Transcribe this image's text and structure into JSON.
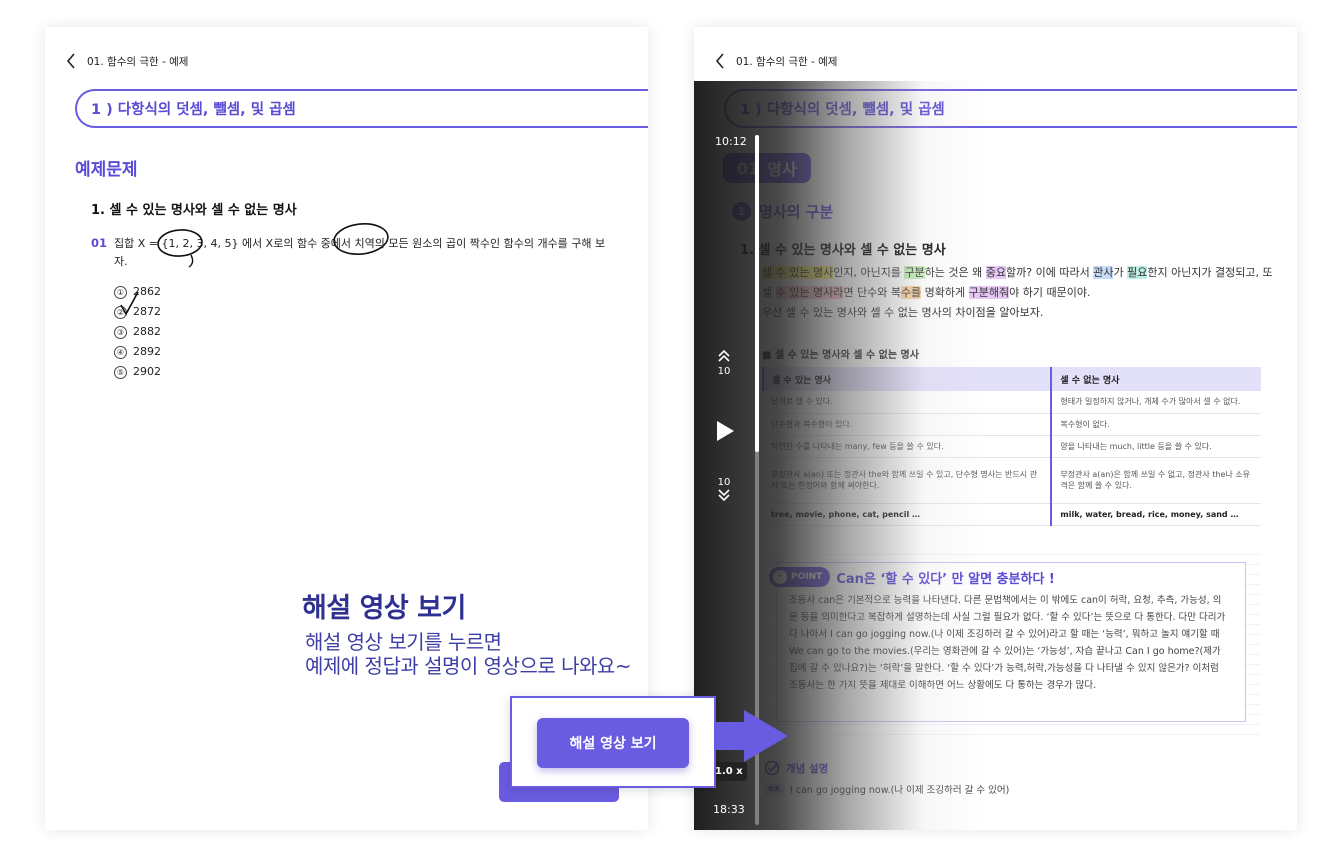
{
  "left_panel": {
    "breadcrumb": "01. 함수의 극한 - 예제",
    "section_title": "1 ) 다항식의 덧셈, 뺄셈, 및 곱셈",
    "example_heading": "예제문제",
    "question_title": "1.  셀 수 있는 명사와 셀 수 없는 명사",
    "question_number": "01",
    "question_text": "집합 X = {1, 2, 3, 4, 5} 에서 X로의 함수 중에서 치역의 모든 원소의 곱이 짝수인 함수의 개수를 구해 보자.",
    "choices": [
      {
        "mark": "①",
        "value": "2862"
      },
      {
        "mark": "②",
        "value": "2872"
      },
      {
        "mark": "③",
        "value": "2882"
      },
      {
        "mark": "④",
        "value": "2892"
      },
      {
        "mark": "⑤",
        "value": "2902"
      }
    ]
  },
  "right_panel": {
    "breadcrumb": "01. 함수의 극한 - 예제",
    "section_title": "1 ) 다항식의 덧셈, 뺄셈, 및 곱셈",
    "badge_number": "01",
    "badge_label": "명사",
    "sub_number": "1",
    "sub_heading": "명사의 구분",
    "question_title": "1.  셀 수 있는 명사와 셀 수 없는 명사",
    "paragraph": {
      "p1": "셀 수 있는 명사",
      "p2": "인지, 아닌지를 ",
      "p3": "구분",
      "p4": "하는 것은 왜 ",
      "p5": "중요",
      "p6": "할까? 이에 따라서 ",
      "p7": "관사",
      "p8": "가 ",
      "p9": "필요",
      "p10": "한지 아닌지가 결정되고, 또 셀 ",
      "p11": "수 있는 명사라",
      "p12": "면 단수와 복",
      "p13": "수를",
      "p14": " 명확하게 ",
      "p15": "구분해줘",
      "p16": "야 하기 때문이야.",
      "p17": "우선 셀 수 있는 명사와 셀 수 없는 명사의 차이점을 알아보자."
    },
    "table_title": "■ 셀 수 있는 명사와 셀 수 없는 명사",
    "table_headers": [
      "셀 수 있는 명사",
      "셀 수 없는 명사"
    ],
    "table_rows": [
      [
        "낱개로 셀 수 있다.",
        "형태가 일정하지 않거나, 개체 수가 많아서 셀 수 없다."
      ],
      [
        "단수형과 복수형이 있다.",
        "복수형이 없다."
      ],
      [
        "막연한 수를 나타내는 many, few 등을 쓸 수 있다.",
        "양을 나타내는 much, little 등을 쓸 수 있다."
      ],
      [
        "부정관사 a(an) 또는 정관사 the와 함께 쓰일 수 있고, 단수형 명사는 반드시 관사 또는 한정어와 함께 써야한다.",
        "부정관사 a(an)은 함께 쓰일 수 없고, 정관사 the나 소유격은 함께 쓸 수 있다."
      ],
      [
        "tree, movie, phone, cat, pencil …",
        "milk, water, bread, rice, money, sand …"
      ]
    ],
    "point_tag": "POINT",
    "point_title": "Can은 ‘할 수 있다’ 만 알면 충분하다 !",
    "point_body": "조동사 can은 기본적으로 능력을 나타낸다. 다른 문법책에서는 이 밖에도 can이 허락, 요청, 추측, 가능성, 의문 등을 의미한다고 복잡하게 설명하는데 사실 그럴 필요가 없다. ‘할 수 있다’는 뜻으로 다 통한다. 다만 다리가 다 나아서 I can go jogging now.(나 이제 조깅하러 갈 수 있어)라고 할 때는 ‘능력’, 뭐하고 놀지 얘기할 때 We can go to the movies.(우리는 영화관에 갈 수 있어)는 ‘가능성’, 자습 끝나고 Can I go home?(제가 집에 갈 수 있나요?)는 ‘허락’을 말한다. ‘할 수 있다’가 능력,허락,가능성을 다 나타낼 수 있지 않은가? 이처럼 조동사는 한 가지 뜻을 제대로 이해하면 어느 상황에도 다 통하는 경우가 많다.",
    "concept_label": "개념 설명",
    "example_tag": "ex",
    "example_text": "I can go jogging now.(나 이제 조깅하러 갈 수 있어)"
  },
  "video_player": {
    "current_time": "10:12",
    "total_time": "18:33",
    "skip_back": "10",
    "skip_forward": "10",
    "speed": "1.0 x",
    "progress": 0.46
  },
  "callout": {
    "title": "해설 영상 보기",
    "line1": "해설 영상 보기를 누르면",
    "line2": "예제에 정답과 설명이 영상으로 나와요~",
    "button_label": "해설 영상 보기"
  },
  "colors": {
    "accent": "#6a5ce0",
    "accent_text": "#5a4bd6",
    "callout_text": "#2e3191"
  }
}
